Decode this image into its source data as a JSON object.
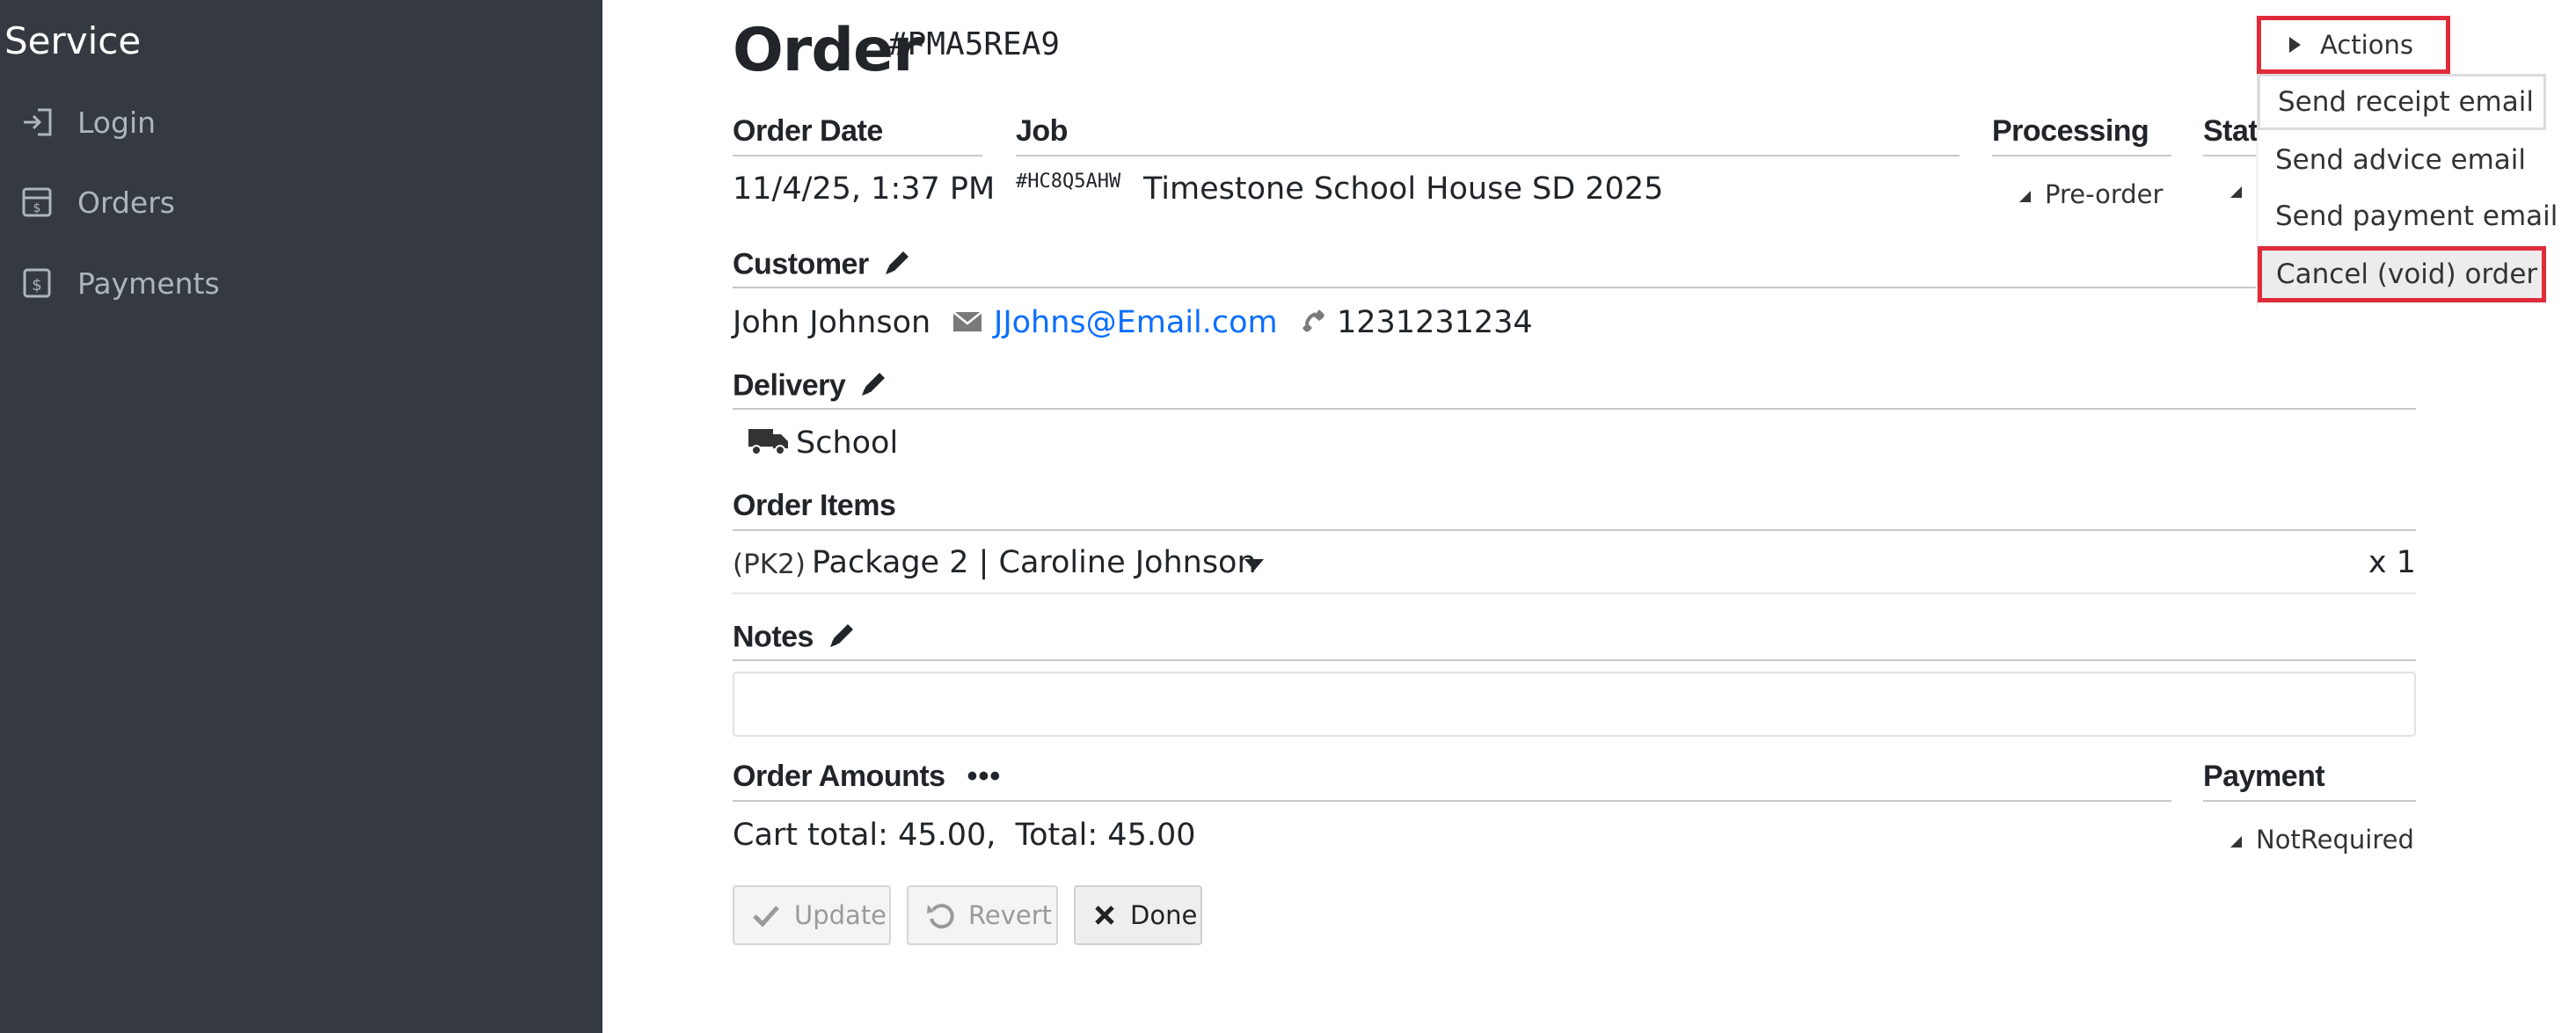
{
  "sidebar": {
    "brand": "Service",
    "items": [
      {
        "label": "Login",
        "icon": "sign-in-icon"
      },
      {
        "label": "Orders",
        "icon": "box-icon"
      },
      {
        "label": "Payments",
        "icon": "dollar-box-icon"
      }
    ]
  },
  "order": {
    "title": "Order",
    "number": "#PMA5REA9",
    "order_date_label": "Order Date",
    "order_date": "11/4/25, 1:37 PM",
    "job_label": "Job",
    "job_code": "#HC8Q5AHW",
    "job_name": "Timestone School House SD 2025",
    "processing_label": "Processing",
    "processing_value": "Pre-order",
    "status_label": "Stat"
  },
  "customer": {
    "label": "Customer",
    "name": "John Johnson",
    "email": "JJohns@Email.com",
    "phone": "1231231234"
  },
  "delivery": {
    "label": "Delivery",
    "value": "School"
  },
  "items": {
    "label": "Order Items",
    "rows": [
      {
        "code": "(PK2)",
        "name": "Package 2 | Caroline Johnson",
        "qty": "x 1"
      }
    ]
  },
  "notes": {
    "label": "Notes"
  },
  "amounts": {
    "label": "Order Amounts",
    "more": "•••",
    "text": "Cart total: 45.00,  Total: 45.00",
    "payment_label": "Payment",
    "payment_value": "NotRequired"
  },
  "buttons": {
    "update": "Update",
    "revert": "Revert",
    "done": "Done"
  },
  "actions": {
    "label": "Actions",
    "menu": [
      "Send receipt email",
      "Send advice email",
      "Send payment email",
      "Cancel (void) order"
    ]
  },
  "colors": {
    "sidebar_bg": "#343a40",
    "highlight": "#e02b3a",
    "link": "#0d6efd"
  }
}
